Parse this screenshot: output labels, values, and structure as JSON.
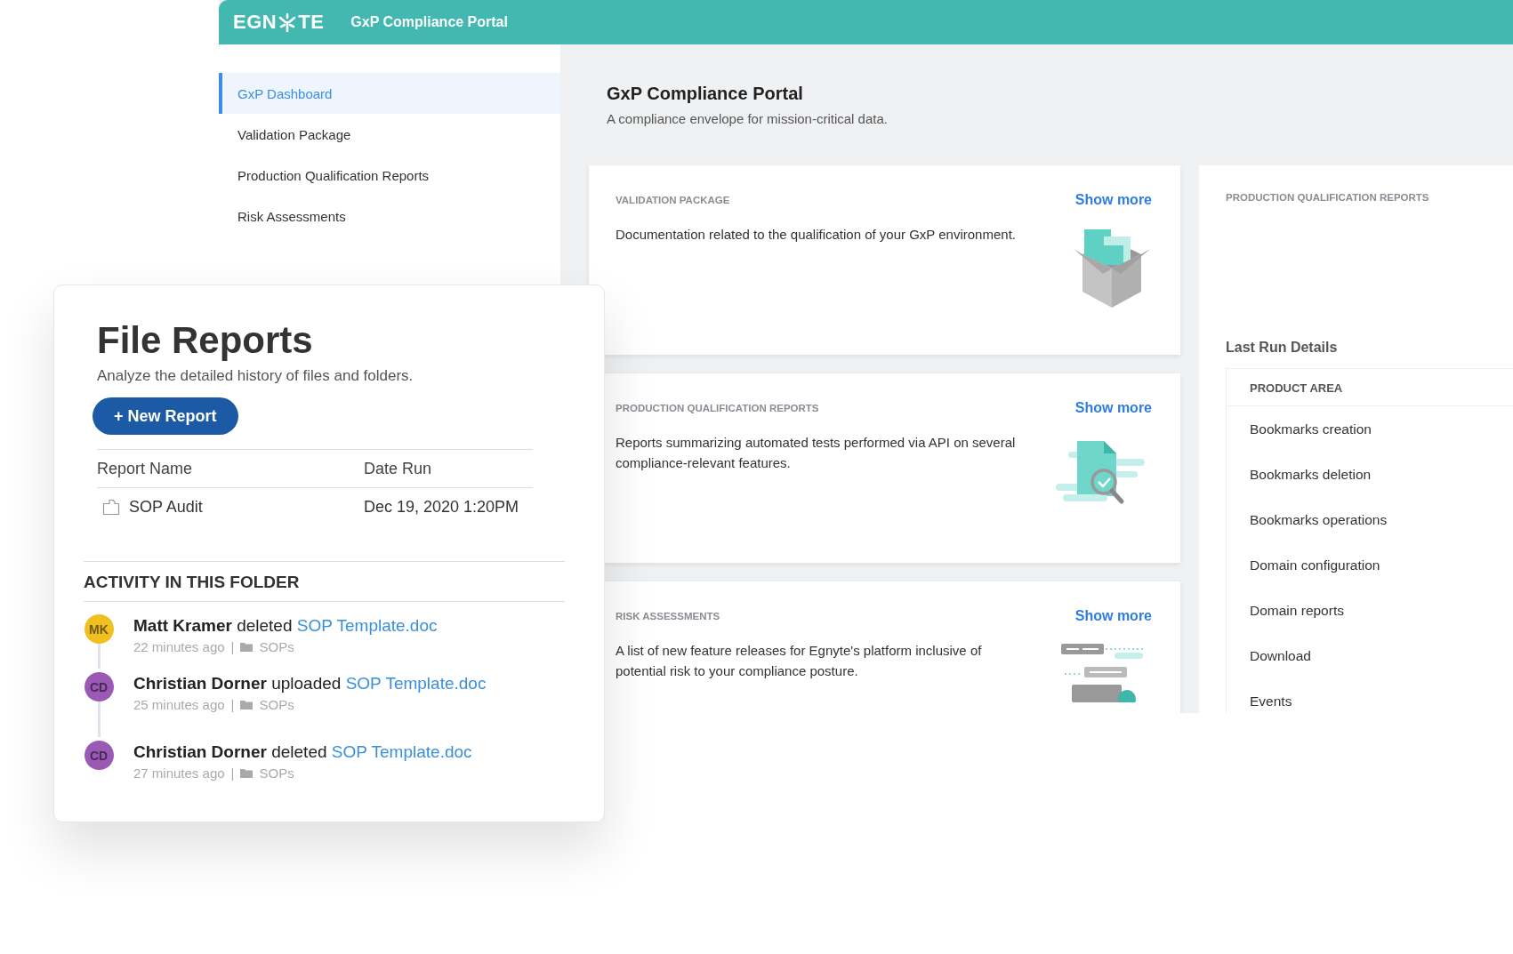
{
  "top_bar": {
    "logo_start": "EGN",
    "logo_end": "TE",
    "title": "GxP Compliance Portal"
  },
  "sidebar": {
    "items": [
      {
        "label": "GxP Dashboard",
        "selected": true
      },
      {
        "label": "Validation Package",
        "selected": false
      },
      {
        "label": "Production Qualification Reports",
        "selected": false
      },
      {
        "label": "Risk Assessments",
        "selected": false
      }
    ]
  },
  "main": {
    "title": "GxP Compliance Portal",
    "subtitle": "A compliance envelope for mission-critical data.",
    "cards": [
      {
        "kind": "box",
        "heading": "VALIDATION PACKAGE",
        "link": "Show more",
        "description": "Documentation related to the qualification of your GxP environment."
      },
      {
        "kind": "inspect",
        "heading": "PRODUCTION QUALIFICATION REPORTS",
        "link": "Show more",
        "description": "Reports summarizing automated tests performed via API on several compliance-relevant features."
      },
      {
        "kind": "flow",
        "heading": "RISK ASSESSMENTS",
        "link": "Show more",
        "description": "A list of new feature releases for Egnyte's platform inclusive of potential risk to your compliance posture."
      }
    ]
  },
  "right_panel": {
    "heading": "PRODUCTION QUALIFICATION REPORTS",
    "section_title": "Last Run Details",
    "column": "PRODUCT AREA",
    "rows": [
      "Bookmarks creation",
      "Bookmarks deletion",
      "Bookmarks operations",
      "Domain configuration",
      "Domain reports",
      "Download",
      "Events"
    ]
  },
  "file_reports": {
    "title": "File Reports",
    "subtitle": "Analyze the detailed history of files and folders.",
    "button": "+ New Report",
    "columns": [
      "Report Name",
      "Date Run"
    ],
    "rows": [
      {
        "name": "SOP Audit",
        "date": "Dec 19, 2020 1:20PM"
      }
    ],
    "activity": {
      "heading": "ACTIVITY IN THIS FOLDER",
      "items": [
        {
          "initials": "MK",
          "color": "#f0c020",
          "user": "Matt Kramer",
          "action": "deleted",
          "file": "SOP Template.doc",
          "time": "22 minutes ago",
          "separator": "|",
          "folder": "SOPs"
        },
        {
          "initials": "CD",
          "color": "#9b59b6",
          "user": "Christian Dorner",
          "action": "uploaded",
          "file": "SOP Template.doc",
          "time": "25 minutes ago",
          "separator": "|",
          "folder": "SOPs"
        },
        {
          "initials": "CD",
          "color": "#9b59b6",
          "user": "Christian Dorner",
          "action": "deleted",
          "file": "SOP Template.doc",
          "time": "27 minutes ago",
          "separator": "|",
          "folder": "SOPs"
        }
      ]
    }
  }
}
